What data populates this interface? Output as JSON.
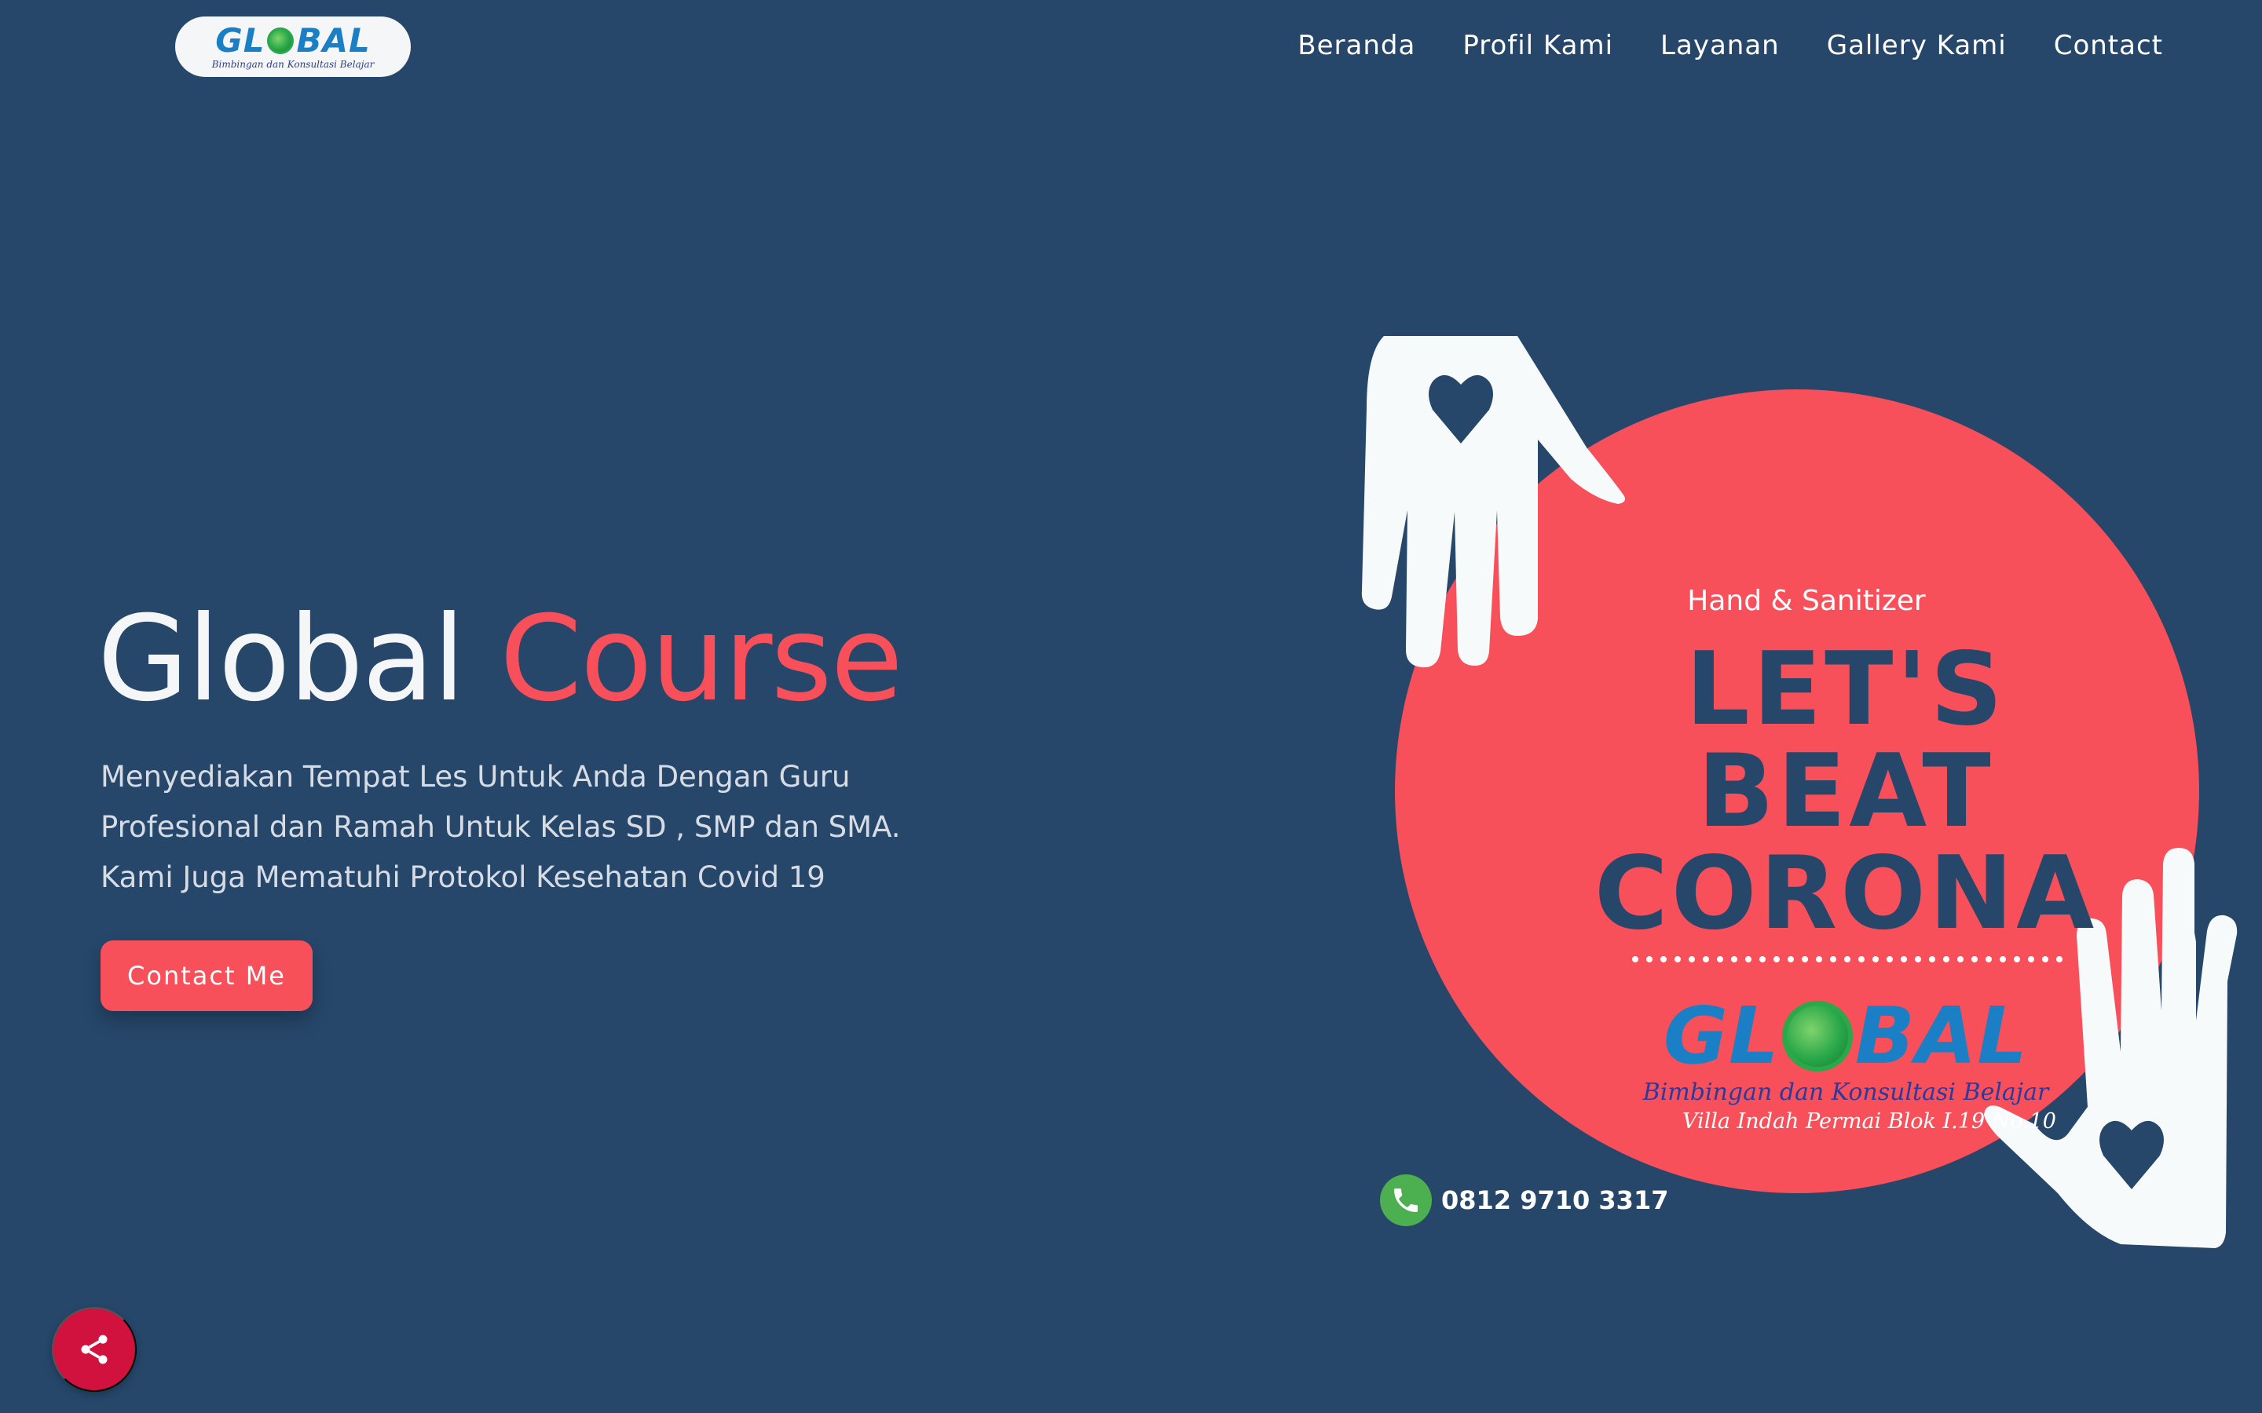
{
  "navbar": {
    "logo": {
      "wordmark": "GL  BAL",
      "tagline": "Bimbingan dan Konsultasi Belajar"
    },
    "links": [
      "Beranda",
      "Profil Kami",
      "Layanan",
      "Gallery Kami",
      "Contact"
    ]
  },
  "hero": {
    "title_part1": "Global",
    "title_part2": "Course",
    "description": "Menyediakan Tempat Les Untuk Anda Dengan Guru Profesional dan Ramah Untuk Kelas SD , SMP dan SMA. Kami Juga Mematuhi Protokol Kesehatan Covid 19",
    "cta_label": "Contact Me"
  },
  "poster": {
    "subtitle": "Hand & Sanitizer",
    "slogan_line1": "LET'S",
    "slogan_line2": "BEAT",
    "slogan_line3": "CORONA",
    "logo_wordmark": "GL  BAL",
    "logo_tagline": "Bimbingan dan Konsultasi Belajar",
    "address": "Villa Indah Permai Blok I.19 No.10",
    "whatsapp_number": "0812 9710 3317"
  },
  "colors": {
    "background": "#26476a",
    "accent": "#f7505b",
    "share_button": "#d1123f",
    "whatsapp": "#4caf50"
  },
  "icons": {
    "whatsapp": "whatsapp-icon",
    "share": "share-icon",
    "globe": "globe-icon",
    "hand": "hand-heart-icon"
  }
}
